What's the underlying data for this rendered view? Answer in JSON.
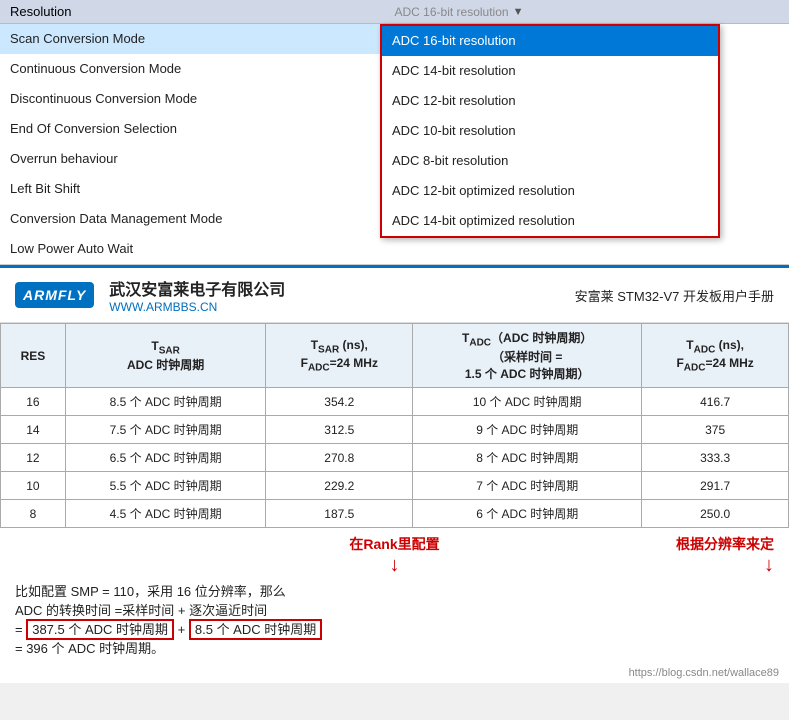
{
  "topSection": {
    "resolutionLabel": "Resolution",
    "resolutionCurrentValue": "ADC 16-bit resolution",
    "settingsItems": [
      {
        "label": "Scan Conversion Mode",
        "highlighted": true
      },
      {
        "label": "Continuous Conversion Mode",
        "highlighted": false
      },
      {
        "label": "Discontinuous Conversion Mode",
        "highlighted": false
      },
      {
        "label": "End Of Conversion Selection",
        "highlighted": false
      },
      {
        "label": "Overrun behaviour",
        "highlighted": false
      },
      {
        "label": "Left Bit Shift",
        "highlighted": false
      },
      {
        "label": "Conversion Data Management Mode",
        "highlighted": false
      },
      {
        "label": "Low Power Auto Wait",
        "highlighted": false
      }
    ],
    "dropdownItems": [
      {
        "label": "ADC 16-bit resolution",
        "selected": true
      },
      {
        "label": "ADC 14-bit resolution",
        "selected": false
      },
      {
        "label": "ADC 12-bit resolution",
        "selected": false
      },
      {
        "label": "ADC 10-bit resolution",
        "selected": false
      },
      {
        "label": "ADC 8-bit resolution",
        "selected": false
      },
      {
        "label": "ADC 12-bit optimized resolution",
        "selected": false
      },
      {
        "label": "ADC 14-bit optimized resolution",
        "selected": false
      }
    ]
  },
  "bottomSection": {
    "logoText": "ARMFLY",
    "companyName": "武汉安富莱电子有限公司",
    "website": "WWW.ARMBBS.CN",
    "manualTitle": "安富莱 STM32-V7 开发板用户手册",
    "tableHeaders": [
      "RES",
      "T_SAR\nADC 时钟周期",
      "T_SAR (ns),\nF_ADC=24 MHz",
      "T_ADC（ADC 时钟周期）\n（采样时间 =\n1.5 个 ADC 时钟周期）",
      "T_ADC (ns),\nF_ADC=24 MHz"
    ],
    "tableRows": [
      {
        "res": "16",
        "tsar": "8.5 个 ADC 时钟周期",
        "tsarNs": "354.2",
        "tadc": "10 个 ADC 时钟周期",
        "tadcNs": "416.7"
      },
      {
        "res": "14",
        "tsar": "7.5 个 ADC 时钟周期",
        "tsarNs": "312.5",
        "tadc": "9 个 ADC 时钟周期",
        "tadcNs": "375"
      },
      {
        "res": "12",
        "tsar": "6.5 个 ADC 时钟周期",
        "tsarNs": "270.8",
        "tadc": "8 个 ADC 时钟周期",
        "tadcNs": "333.3"
      },
      {
        "res": "10",
        "tsar": "5.5 个 ADC 时钟周期",
        "tsarNs": "229.2",
        "tadc": "7 个 ADC 时钟周期",
        "tadcNs": "291.7"
      },
      {
        "res": "8",
        "tsar": "4.5 个 ADC 时钟周期",
        "tsarNs": "187.5",
        "tadc": "6 个 ADC 时钟周期",
        "tadcNs": "250.0"
      }
    ],
    "annotationCenter": "在Rank里配置",
    "annotationRight": "根据分辨率来定",
    "formulaLine1": "比如配置 SMP = 110，采用 16 位分辨率，那么",
    "formulaLine2": "ADC 的转换时间 =采样时间 + 逐次逼近时间",
    "formulaLine3_prefix": "= ",
    "formulaLine3_box1": "387.5 个 ADC 时钟周期",
    "formulaLine3_plus": " + ",
    "formulaLine3_box2": "8.5 个 ADC 时钟周期",
    "formulaLine4": "= 396 个 ADC 时钟周期。",
    "urlText": "https://blog.csdn.net/wallace89"
  }
}
